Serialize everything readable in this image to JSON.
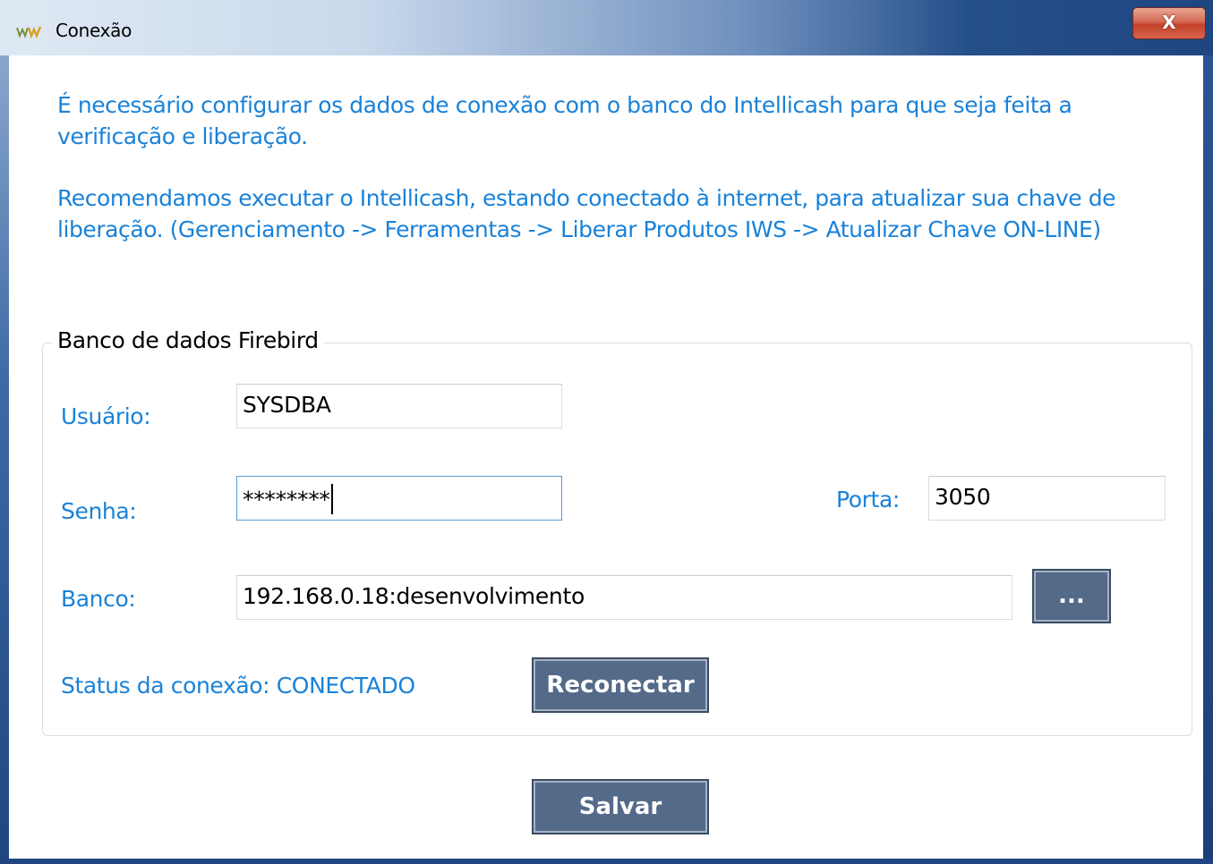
{
  "window": {
    "title": "Conexão",
    "close_label": "X"
  },
  "info": {
    "paragraph1": "É necessário configurar os dados de conexão com o banco do Intellicash para que seja feita a verificação e liberação.",
    "paragraph2": "Recomendamos executar o Intellicash, estando conectado à internet, para atualizar sua chave de liberação. (Gerenciamento -> Ferramentas -> Liberar Produtos IWS -> Atualizar Chave ON-LINE)"
  },
  "group": {
    "legend": "Banco de dados Firebird",
    "usuario_label": "Usuário:",
    "usuario_value": "SYSDBA",
    "senha_label": "Senha:",
    "senha_value": "********",
    "porta_label": "Porta:",
    "porta_value": "3050",
    "banco_label": "Banco:",
    "banco_value": "192.168.0.18:desenvolvimento",
    "browse_label": "...",
    "status_text": "Status da conexão: CONECTADO",
    "reconnect_label": "Reconectar"
  },
  "footer": {
    "save_label": "Salvar"
  },
  "colors": {
    "accent_text": "#1a82d8",
    "button_bg": "#546a89",
    "close_button": "#c4402a"
  }
}
